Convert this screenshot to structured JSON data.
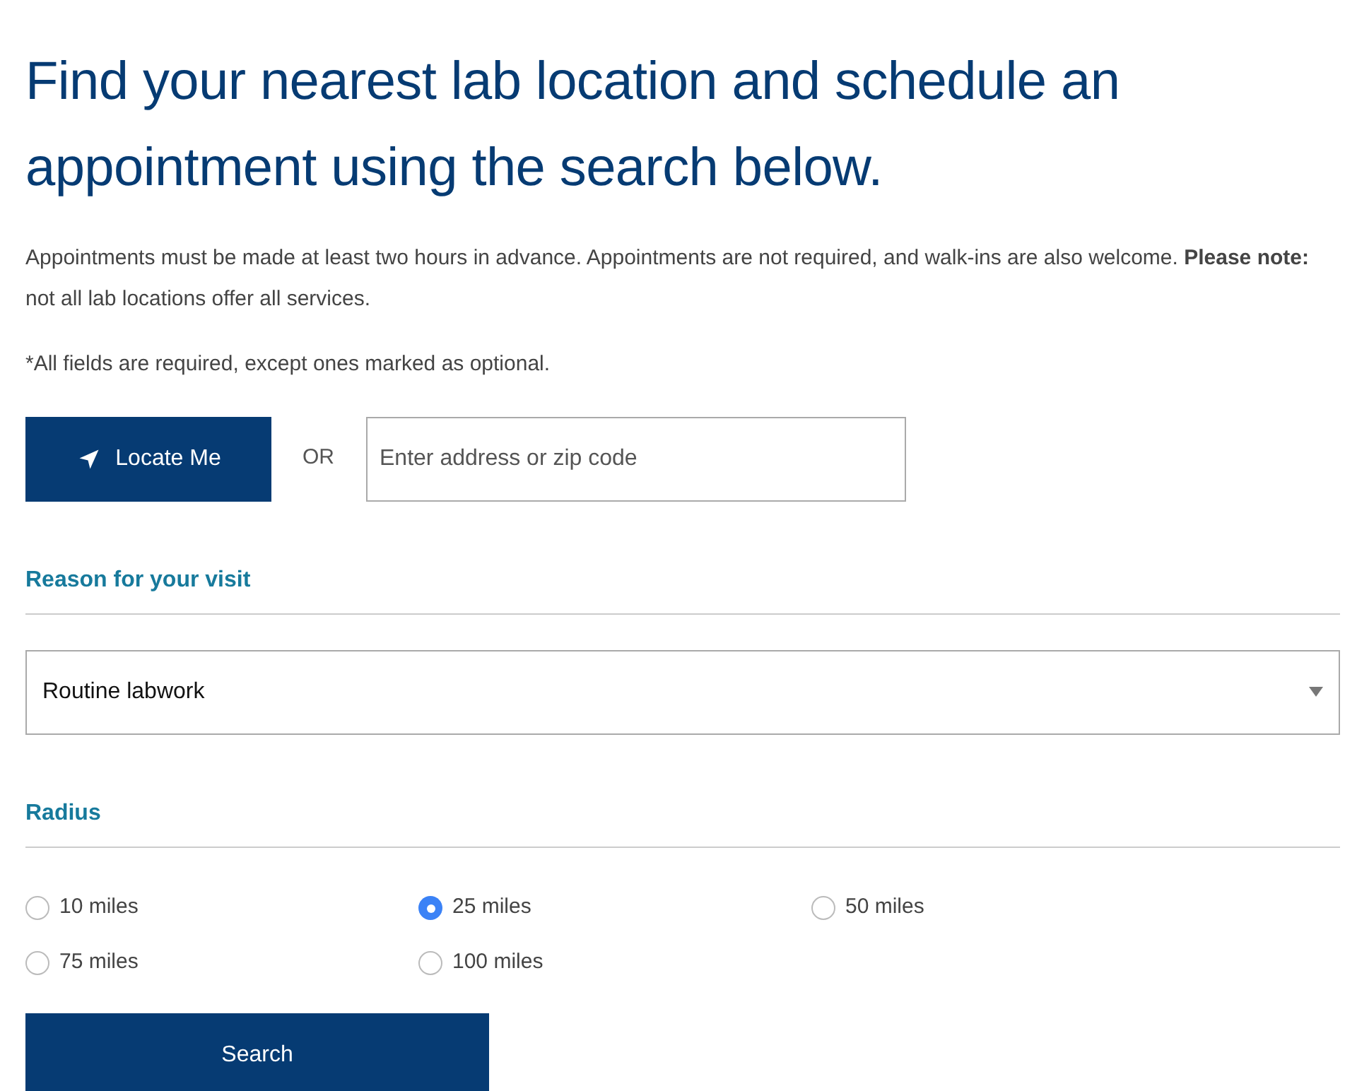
{
  "heading": "Find your nearest lab location and schedule an appointment using the search below.",
  "intro": "Appointments must be made at least two hours in advance. Appointments are not required, and walk-ins are also welcome. **Please note:** not all lab locations offer all services.",
  "required_note": "*All fields are required, except ones marked as optional.",
  "locate_button": "Locate Me",
  "or_label": "OR",
  "address_field": {
    "placeholder": "Enter address or zip code"
  },
  "reason": {
    "label": "Reason for your visit",
    "value": "Routine labwork"
  },
  "radius": {
    "label": "Radius",
    "options": [
      {
        "label": "10 miles",
        "selected": false
      },
      {
        "label": "25 miles",
        "selected": true
      },
      {
        "label": "50 miles",
        "selected": false
      },
      {
        "label": "75 miles",
        "selected": false
      },
      {
        "label": "100 miles",
        "selected": false
      }
    ]
  },
  "search_button": "Search"
}
